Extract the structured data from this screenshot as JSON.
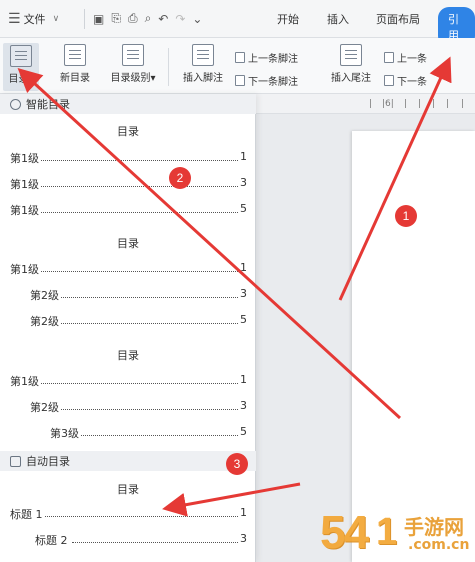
{
  "menubar": {
    "file_label": "文件",
    "tabs": [
      {
        "label": "开始"
      },
      {
        "label": "插入"
      },
      {
        "label": "页面布局"
      },
      {
        "label": "引用",
        "active": true
      }
    ]
  },
  "ribbon": {
    "toc_label": "目录",
    "update_toc_label": "新目录",
    "toc_level_label": "目录级别",
    "insert_footnote_label": "插入脚注",
    "prev_footnote_label": "上一条脚注",
    "next_footnote_label": "下一条脚注",
    "insert_endnote_label": "插入尾注",
    "prev_endnote_label": "上一条",
    "next_endnote_label": "下一条"
  },
  "panel": {
    "smart_toc_header": "智能目录",
    "auto_toc_header": "自动目录",
    "blocks": [
      {
        "title": "目录",
        "entries": [
          {
            "label": "第1级",
            "page": "1"
          },
          {
            "label": "第1级",
            "page": "3"
          },
          {
            "label": "第1级",
            "page": "5"
          }
        ]
      },
      {
        "title": "目录",
        "entries": [
          {
            "label": "第1级",
            "page": "1"
          },
          {
            "label": "第2级",
            "page": "3"
          },
          {
            "label": "第2级",
            "page": "5"
          }
        ]
      },
      {
        "title": "目录",
        "entries": [
          {
            "label": "第1级",
            "page": "1"
          },
          {
            "label": "第2级",
            "page": "3"
          },
          {
            "label": "第3级",
            "page": "5"
          }
        ]
      }
    ],
    "auto_block": {
      "title": "目录",
      "entries": [
        {
          "label": "标题 1",
          "page": "1"
        },
        {
          "label": "标题 2",
          "page": "3"
        }
      ]
    }
  },
  "ruler": {
    "marks": [
      "|",
      "|6|",
      "|",
      "|",
      "|",
      "|",
      "|"
    ]
  },
  "annotations": {
    "badges": [
      "1",
      "2",
      "3"
    ],
    "color": "#e53935"
  },
  "watermark": {
    "digits": "54",
    "glyph": "1",
    "text": "手游网",
    "domain": ".com.cn"
  },
  "colors": {
    "accent": "#2f84e6",
    "arrow": "#e53935"
  }
}
